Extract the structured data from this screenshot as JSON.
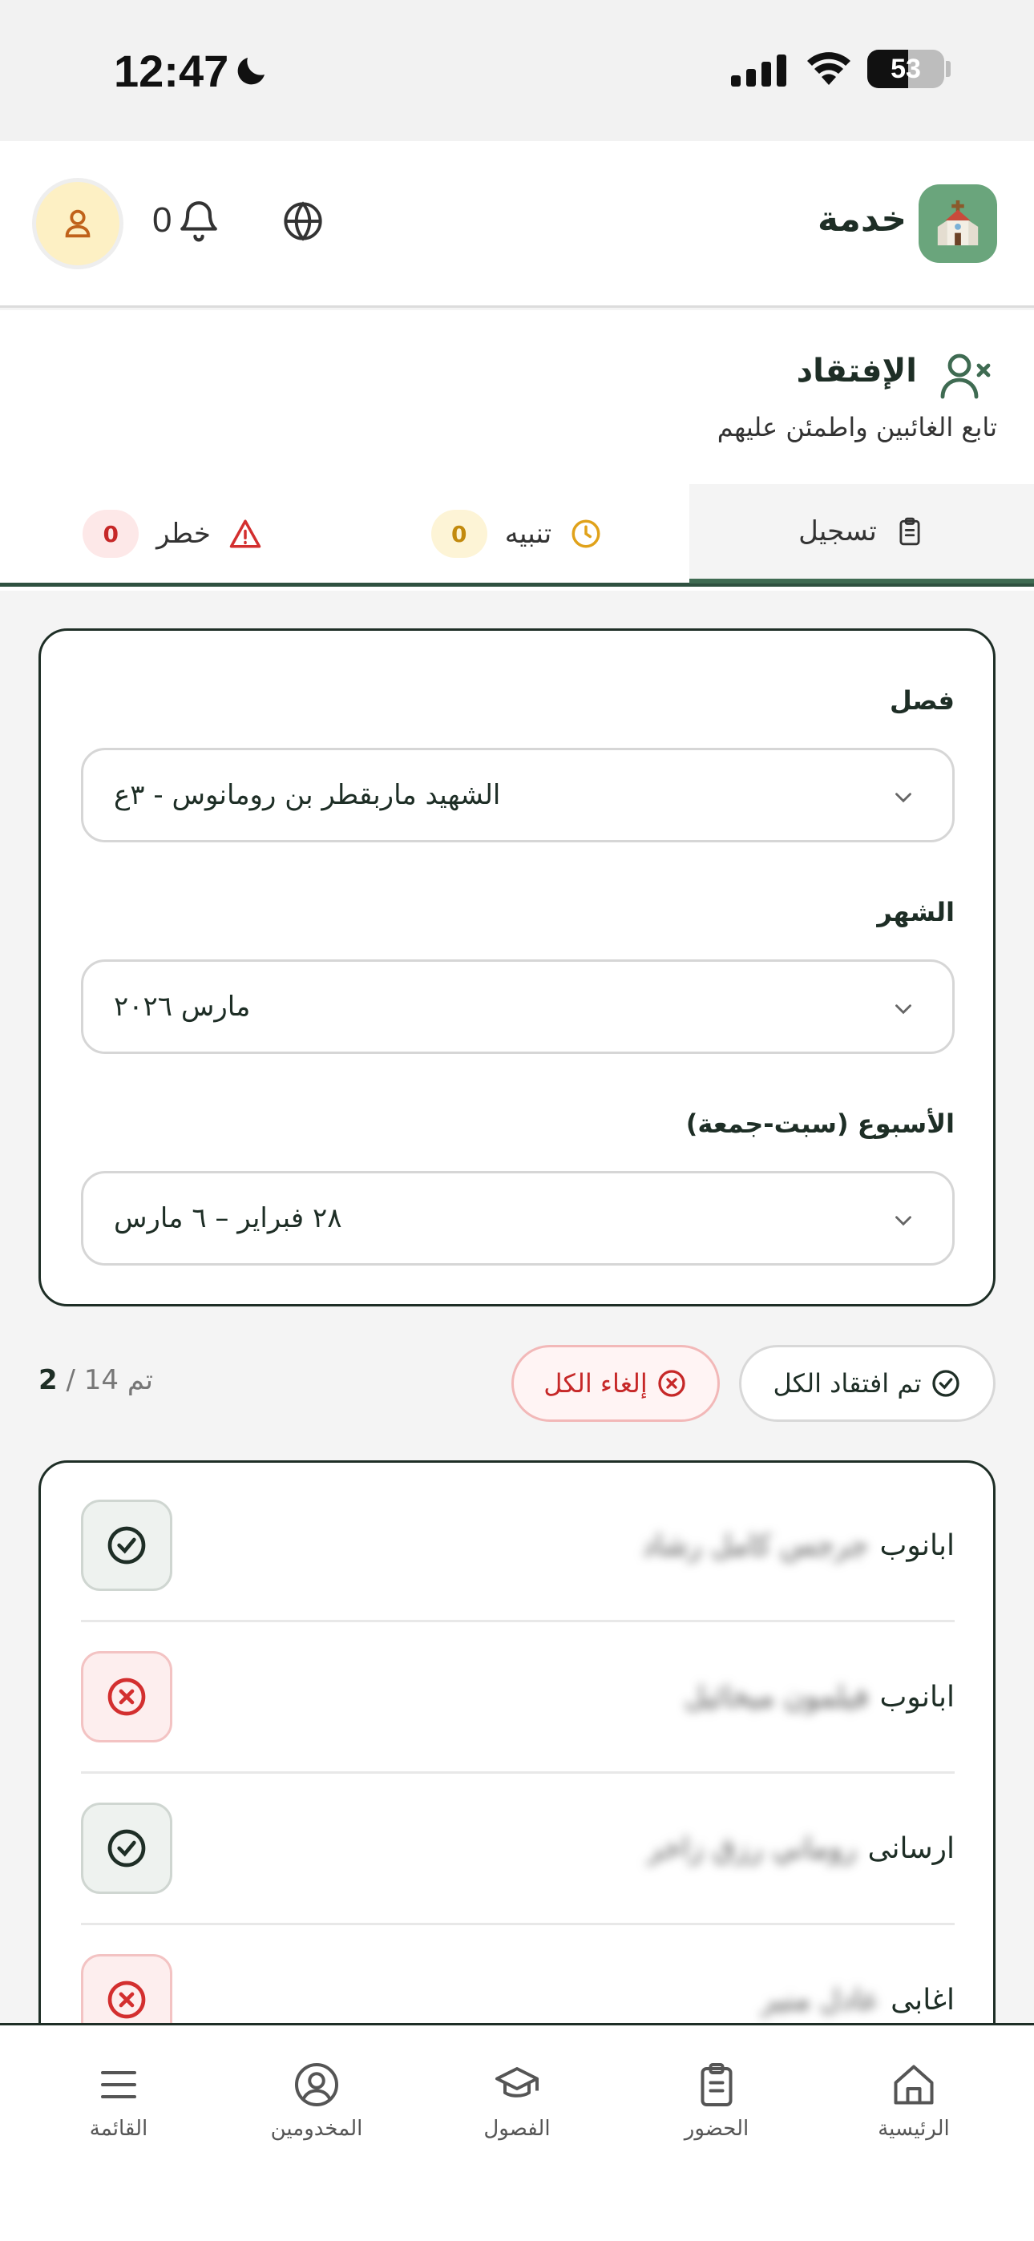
{
  "status_bar": {
    "time": "12:47",
    "battery": "53",
    "battery_level": 0.53
  },
  "header": {
    "brand": "خدمة",
    "notification_count": "0"
  },
  "page": {
    "title": "الإفتقاد",
    "subtitle": "تابع الغائبين واطمئن عليهم"
  },
  "tabs": [
    {
      "label": "تسجيل",
      "icon": "clipboard-icon",
      "active": true
    },
    {
      "label": "تنبيه",
      "count": "0",
      "icon": "clock-icon",
      "color": "#e0a21a"
    },
    {
      "label": "خطر",
      "count": "0",
      "icon": "warning-icon",
      "color": "#d32f2f"
    }
  ],
  "filters": {
    "class_label": "فصل",
    "class_value": "الشهيد ماربقطر بن رومانوس - ٣ع",
    "month_label": "الشهر",
    "month_value": "مارس ٢٠٢٦",
    "week_label": "الأسبوع (سبت-جمعة)",
    "week_value": "٢٨ فبراير – ٦ مارس"
  },
  "actions": {
    "mark_all": "تم افتقاد الكل",
    "cancel_all": "إلغاء الكل",
    "progress_done": "2",
    "progress_total": "/ 14 تم"
  },
  "list": [
    {
      "first": "ابانوب",
      "rest": "جرجس كامل رشاد",
      "status": "done"
    },
    {
      "first": "ابانوب",
      "rest": "فيلمون ميخائيل",
      "status": "missed"
    },
    {
      "first": "ارسانى",
      "rest": "روماني رزق زاخر",
      "status": "done"
    },
    {
      "first": "اغابى",
      "rest": "عادل منير",
      "status": "missed"
    }
  ],
  "nav": [
    {
      "label": "الرئيسية",
      "icon": "home-icon"
    },
    {
      "label": "الحضور",
      "icon": "clipboard-icon"
    },
    {
      "label": "الفصول",
      "icon": "graduation-cap-icon"
    },
    {
      "label": "المخدومين",
      "icon": "user-circle-icon"
    },
    {
      "label": "القائمة",
      "icon": "menu-icon"
    }
  ],
  "colors": {
    "primary": "#2f5140",
    "danger": "#c62828",
    "warning": "#e0a21a",
    "accent_bg": "#6aa57c"
  }
}
